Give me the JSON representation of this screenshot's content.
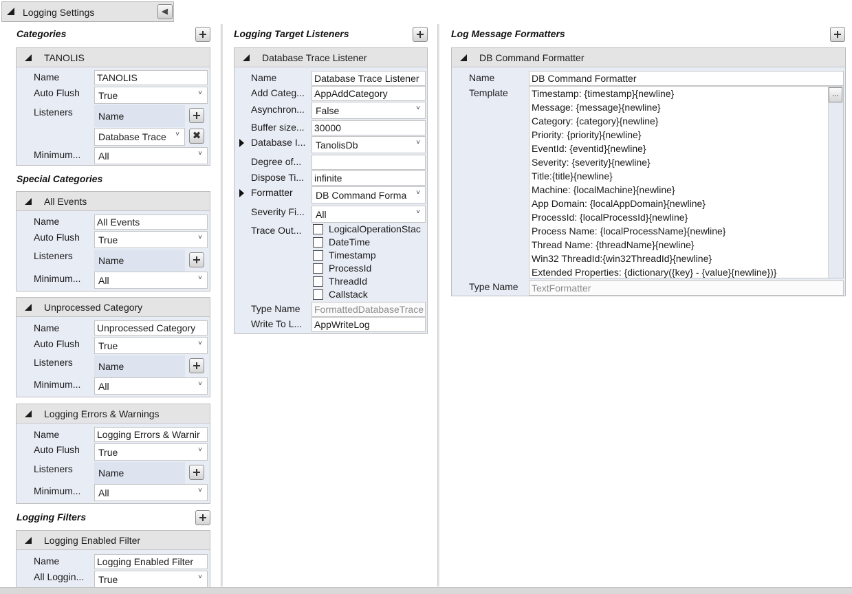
{
  "header": {
    "title": "Logging Settings",
    "collapse_icon": "double-chevron-down-icon"
  },
  "categories": {
    "title": "Categories",
    "items": [
      {
        "header": "TANOLIS",
        "name_label": "Name",
        "name": "TANOLIS",
        "autoflush_label": "Auto Flush",
        "autoflush": "True",
        "listeners_label": "Listeners",
        "listeners_name_label": "Name",
        "listener_value": "Database Trace",
        "minimum_label": "Minimum...",
        "minimum": "All"
      }
    ]
  },
  "special_categories": {
    "title": "Special Categories",
    "items": [
      {
        "header": "All Events",
        "name_label": "Name",
        "name": "All Events",
        "autoflush_label": "Auto Flush",
        "autoflush": "True",
        "listeners_label": "Listeners",
        "listeners_name_label": "Name",
        "minimum_label": "Minimum...",
        "minimum": "All"
      },
      {
        "header": "Unprocessed Category",
        "name_label": "Name",
        "name": "Unprocessed Category",
        "autoflush_label": "Auto Flush",
        "autoflush": "True",
        "listeners_label": "Listeners",
        "listeners_name_label": "Name",
        "minimum_label": "Minimum...",
        "minimum": "All"
      },
      {
        "header": "Logging Errors & Warnings",
        "name_label": "Name",
        "name": "Logging Errors & Warnir",
        "autoflush_label": "Auto Flush",
        "autoflush": "True",
        "listeners_label": "Listeners",
        "listeners_name_label": "Name",
        "minimum_label": "Minimum...",
        "minimum": "All"
      }
    ]
  },
  "logging_filters": {
    "title": "Logging Filters",
    "items": [
      {
        "header": "Logging Enabled Filter",
        "name_label": "Name",
        "name": "Logging Enabled Filter",
        "all_label": "All Loggin...",
        "all": "True"
      }
    ]
  },
  "listeners": {
    "title": "Logging Target Listeners",
    "card": {
      "header": "Database Trace Listener",
      "rows": [
        {
          "label": "Name",
          "value": "Database Trace Listener"
        },
        {
          "label": "Add Categ...",
          "value": "AppAddCategory"
        },
        {
          "label": "Asynchron...",
          "value": "False"
        },
        {
          "label": "Buffer size...",
          "value": "30000"
        },
        {
          "label": "Database I...",
          "value": "TanolisDb"
        },
        {
          "label": "Degree of...",
          "value": ""
        },
        {
          "label": "Dispose Ti...",
          "value": "infinite"
        },
        {
          "label": "Formatter",
          "value": "DB Command Forma"
        },
        {
          "label": "Severity Fi...",
          "value": "All"
        },
        {
          "label": "Trace Out...",
          "value": ""
        }
      ],
      "trace_options": [
        "LogicalOperationStac",
        "DateTime",
        "Timestamp",
        "ProcessId",
        "ThreadId",
        "Callstack"
      ],
      "type_name_label": "Type Name",
      "type_name": "FormattedDatabaseTrace",
      "write_label": "Write To L...",
      "write": "AppWriteLog"
    }
  },
  "formatters": {
    "title": "Log Message Formatters",
    "card": {
      "header": "DB Command Formatter",
      "name_label": "Name",
      "name": "DB Command Formatter",
      "template_label": "Template",
      "template_button": "...",
      "template_lines": [
        "Timestamp: {timestamp}{newline}",
        "Message: {message}{newline}",
        "Category: {category}{newline}",
        "Priority: {priority}{newline}",
        "EventId: {eventid}{newline}",
        "Severity: {severity}{newline}",
        "Title:{title}{newline}",
        "Machine: {localMachine}{newline}",
        "App Domain: {localAppDomain}{newline}",
        "ProcessId: {localProcessId}{newline}",
        "Process Name: {localProcessName}{newline}",
        "Thread Name: {threadName}{newline}",
        "Win32 ThreadId:{win32ThreadId}{newline}",
        "Extended Properties: {dictionary({key} - {value}{newline})}"
      ],
      "type_name_label": "Type Name",
      "type_name": "TextFormatter"
    }
  }
}
